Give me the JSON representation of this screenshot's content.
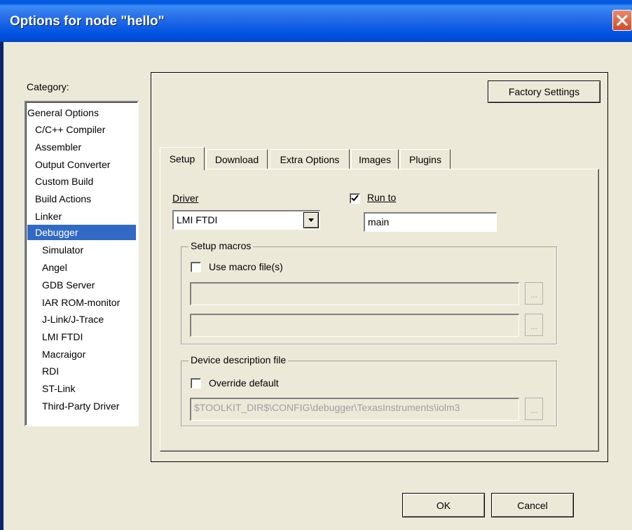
{
  "window": {
    "title": "Options for node \"hello\""
  },
  "category": {
    "label": "Category:",
    "items": [
      {
        "label": "General Options",
        "level": 0,
        "selected": false
      },
      {
        "label": "C/C++ Compiler",
        "level": 1,
        "selected": false
      },
      {
        "label": "Assembler",
        "level": 1,
        "selected": false
      },
      {
        "label": "Output Converter",
        "level": 1,
        "selected": false
      },
      {
        "label": "Custom Build",
        "level": 1,
        "selected": false
      },
      {
        "label": "Build Actions",
        "level": 1,
        "selected": false
      },
      {
        "label": "Linker",
        "level": 1,
        "selected": false
      },
      {
        "label": "Debugger",
        "level": 1,
        "selected": true
      },
      {
        "label": "Simulator",
        "level": 2,
        "selected": false
      },
      {
        "label": "Angel",
        "level": 2,
        "selected": false
      },
      {
        "label": "GDB Server",
        "level": 2,
        "selected": false
      },
      {
        "label": "IAR ROM-monitor",
        "level": 2,
        "selected": false
      },
      {
        "label": "J-Link/J-Trace",
        "level": 2,
        "selected": false
      },
      {
        "label": "LMI FTDI",
        "level": 2,
        "selected": false
      },
      {
        "label": "Macraigor",
        "level": 2,
        "selected": false
      },
      {
        "label": "RDI",
        "level": 2,
        "selected": false
      },
      {
        "label": "ST-Link",
        "level": 2,
        "selected": false
      },
      {
        "label": "Third-Party Driver",
        "level": 2,
        "selected": false
      }
    ]
  },
  "factory_settings_label": "Factory Settings",
  "tabs": [
    {
      "label": "Setup",
      "active": true
    },
    {
      "label": "Download",
      "active": false
    },
    {
      "label": "Extra Options",
      "active": false
    },
    {
      "label": "Images",
      "active": false
    },
    {
      "label": "Plugins",
      "active": false
    }
  ],
  "setup": {
    "driver_label": "Driver",
    "driver_value": "LMI FTDI",
    "run_to_label": "Run to",
    "run_to_checked": true,
    "run_to_value": "main",
    "setup_macros_legend": "Setup macros",
    "use_macro_label": "Use macro file(s)",
    "use_macro_checked": false,
    "macro_file_1": "",
    "macro_file_2": "",
    "browse_label": "...",
    "device_desc_legend": "Device description file",
    "override_label": "Override default",
    "override_checked": false,
    "device_desc_value": "$TOOLKIT_DIR$\\CONFIG\\debugger\\TexasInstruments\\iolm3"
  },
  "ok_label": "OK",
  "cancel_label": "Cancel",
  "colors": {
    "title_bar": "#0054e3",
    "dialog_bg": "#ece9d8",
    "selection": "#316ac5",
    "close_button": "#d24a26"
  }
}
